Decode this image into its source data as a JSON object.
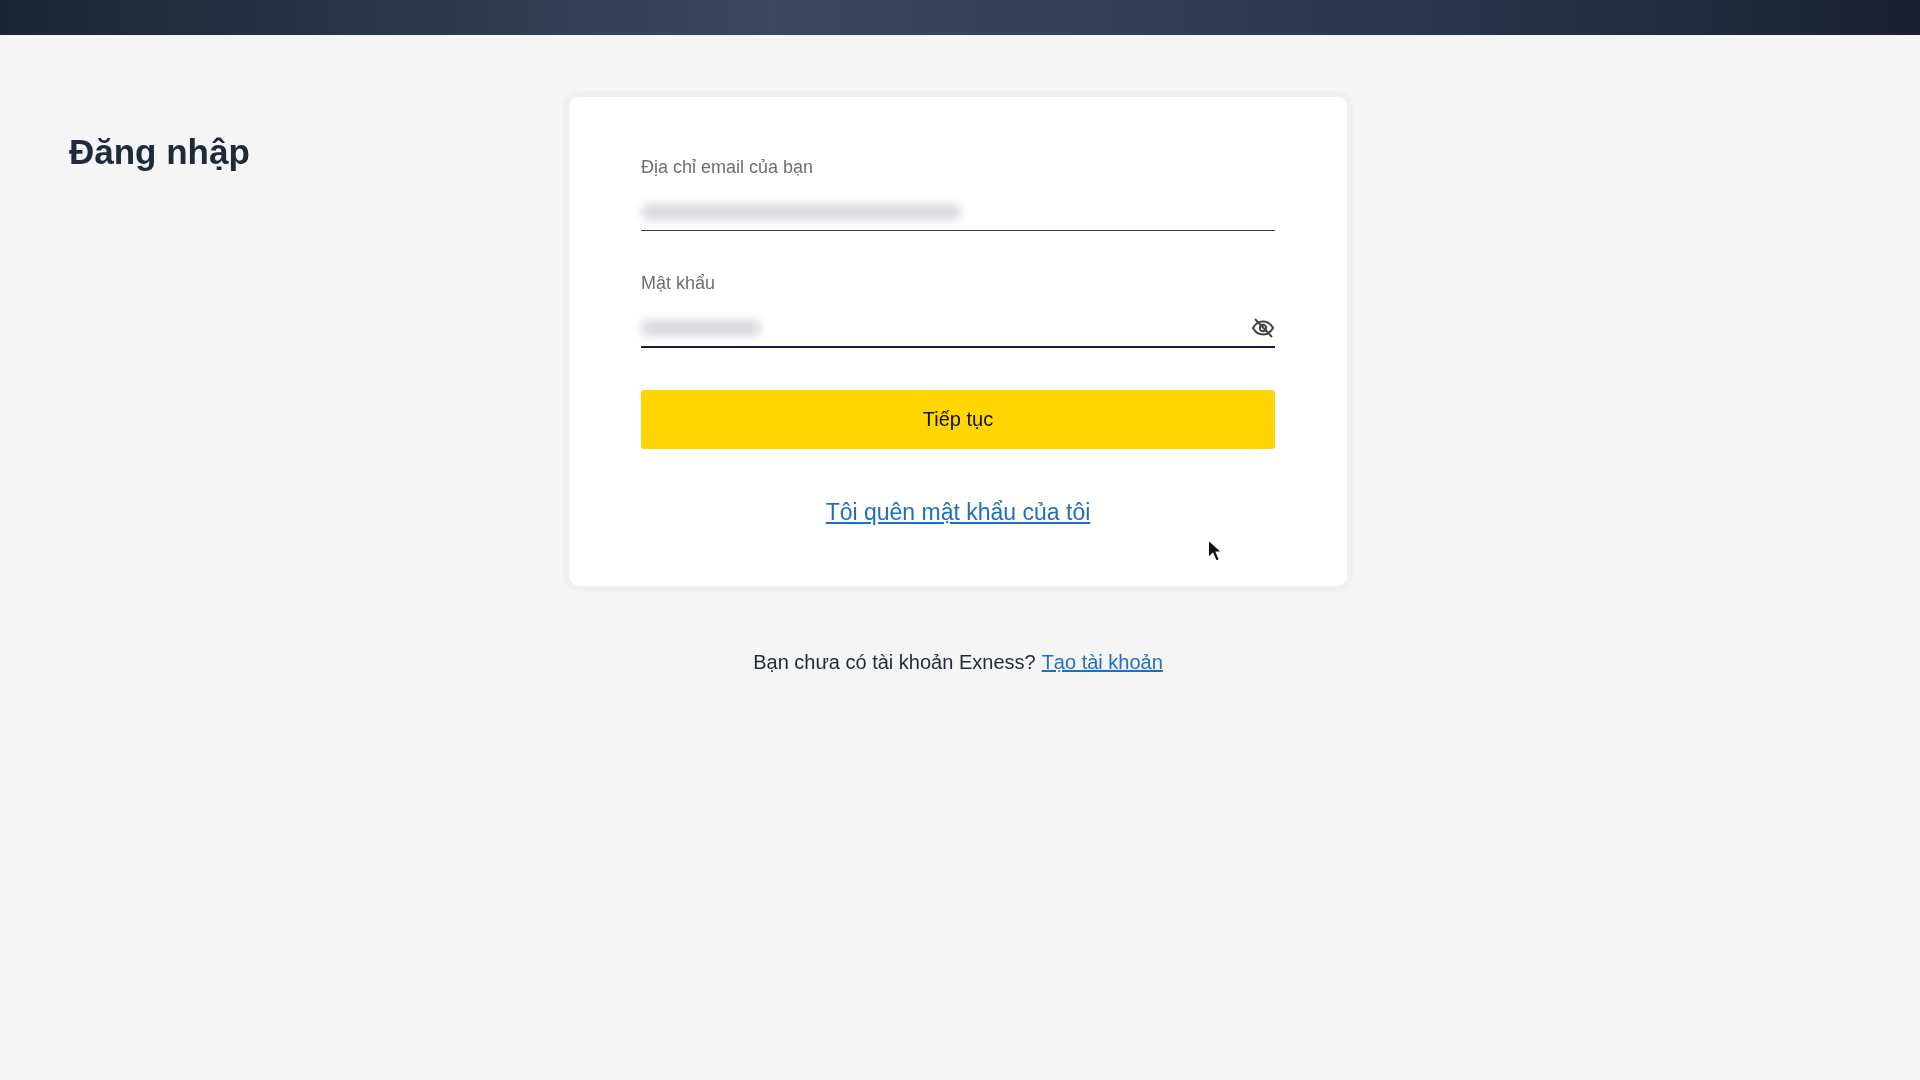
{
  "page_title": "Đăng nhập",
  "form": {
    "fields": [
      {
        "kind": "email",
        "label": "Địa chỉ email của bạn",
        "focused": false
      },
      {
        "kind": "password",
        "label": "Mật khẩu",
        "focused": true
      }
    ],
    "submit": "Tiếp tục",
    "forgot_link": "Tôi quên mật khẩu của tôi"
  },
  "signup": {
    "prompt": "Bạn chưa có tài khoản Exness?",
    "link": "Tạo tài khoản"
  }
}
